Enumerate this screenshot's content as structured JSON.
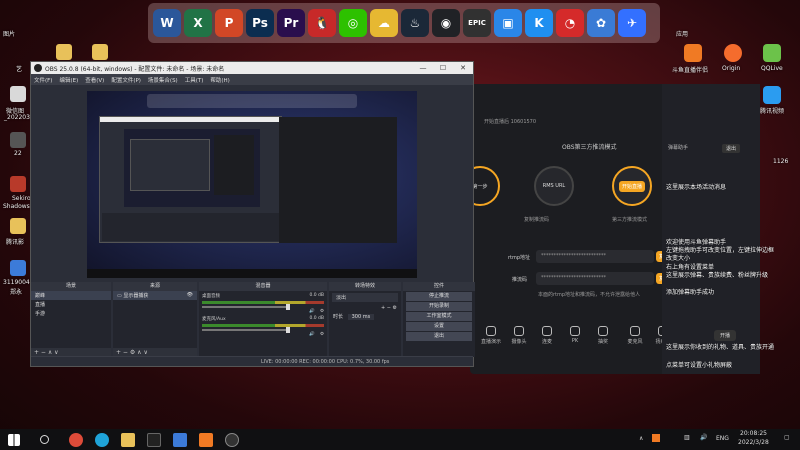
{
  "dock": {
    "apps": [
      {
        "name": "word",
        "label": "W",
        "color": "#2b579a"
      },
      {
        "name": "excel",
        "label": "X",
        "color": "#217346"
      },
      {
        "name": "powerpoint",
        "label": "P",
        "color": "#d24726"
      },
      {
        "name": "photoshop",
        "label": "Ps",
        "color": "#0b2d50"
      },
      {
        "name": "premiere",
        "label": "Pr",
        "color": "#2a0e4d"
      },
      {
        "name": "qq",
        "label": "🐧",
        "color": "#c72929"
      },
      {
        "name": "wechat",
        "label": "◎",
        "color": "#2dc100"
      },
      {
        "name": "baidu-netdisk",
        "label": "☁",
        "color": "#e6b832"
      },
      {
        "name": "steam",
        "label": "♨",
        "color": "#1b2838"
      },
      {
        "name": "obs",
        "label": "◉",
        "color": "#202226"
      },
      {
        "name": "epic-games",
        "label": "EPIC",
        "color": "#313131"
      },
      {
        "name": "screenshot",
        "label": "▣",
        "color": "#2a86e8"
      },
      {
        "name": "kugou",
        "label": "K",
        "color": "#1f8ff0"
      },
      {
        "name": "netease-music",
        "label": "◔",
        "color": "#d52a2a"
      },
      {
        "name": "qq-space",
        "label": "✿",
        "color": "#3a7bd5"
      },
      {
        "name": "feishu",
        "label": "✈",
        "color": "#3370ff"
      }
    ]
  },
  "desktop_left": {
    "items": [
      {
        "label": "图片"
      },
      {
        "label": "艺"
      },
      {
        "label": "微信图"
      },
      {
        "label": "_202203"
      },
      {
        "label": "22"
      },
      {
        "label": "Sekiro"
      },
      {
        "label": "Shadows"
      },
      {
        "label": "腾讯影"
      },
      {
        "label": "3119004"
      },
      {
        "label": "郑永"
      }
    ]
  },
  "desktop_right": {
    "title": "应用",
    "items": [
      {
        "label": "斗鱼直播伴侣",
        "color": "#f07a24"
      },
      {
        "label": "Origin",
        "color": "#f56c2d"
      },
      {
        "label": "QQLive",
        "color": "#6cc24a"
      },
      {
        "label": "腾讯视频",
        "color": "#2b9cf0"
      }
    ]
  },
  "obs": {
    "title": "OBS 25.0.8 (64-bit, windows) - 配置文件: 未命名 - 场景: 未命名",
    "menu": [
      "文件(F)",
      "编辑(E)",
      "查看(V)",
      "配置文件(P)",
      "场景集合(S)",
      "工具(T)",
      "帮助(H)"
    ],
    "docks": {
      "scenes": {
        "title": "场景",
        "items": [
          "巅峰",
          "直播",
          "手游"
        ]
      },
      "sources": {
        "title": "来源",
        "items": [
          "显示器捕获"
        ]
      },
      "mixer": {
        "title": "混音器",
        "channels": [
          {
            "name": "桌面音频",
            "db": "0.0 dB"
          },
          {
            "name": "麦克风/Aux",
            "db": "0.0 dB"
          }
        ]
      },
      "transitions": {
        "title": "转场特效",
        "type": "淡出",
        "duration_label": "时长",
        "duration": "300 ms"
      },
      "controls": {
        "title": "控件",
        "buttons": [
          "停止推流",
          "开始录制",
          "工作室模式",
          "设置",
          "退出"
        ]
      }
    },
    "status": "LIVE: 00:00:00   REC: 00:00:00   CPU: 0.7%, 30.00 fps"
  },
  "live_panel": {
    "header": "OBS第三方推流模式",
    "room": "开始直播后 10601570",
    "steps": [
      {
        "title": "第一步",
        "desc": "开启推流"
      },
      {
        "title": "RMS URL",
        "desc": "复制推流码"
      },
      {
        "title": "开始直播",
        "desc": "第三方推流模式"
      }
    ],
    "rtmp_label": "rtmp地址",
    "rtmp_value": "**************************",
    "key_label": "推流码",
    "key_value": "**************************",
    "copy_label": "复制",
    "hint": "本面的rtmp地址和推流码，不允许泄露给他人",
    "danmu_head": "弹幕助手",
    "exit_label": "退出",
    "likes": "1126",
    "tools": [
      "直播演示",
      "摄像头",
      "连麦",
      "PK",
      "抽奖",
      "麦克风",
      "扬声器"
    ],
    "start_label": "开播"
  },
  "chat_overlay": [
    "这里展示本场活动消息",
    "欢迎使用斗鱼弹幕助手",
    "左键拖拽助手可改变位置，左键拉伸边框",
    "改变大小",
    "右上角有设置菜单",
    "这里展示弹幕、贵族续费、粉丝牌升级",
    "添加弹幕助手成功",
    "这里展示你收到的礼物、道具、贵族开通",
    "点菜单可设置小礼物屏蔽"
  ],
  "taskbar": {
    "time": "20:08:25",
    "date": "2022/3/28",
    "lang": "ENG"
  }
}
